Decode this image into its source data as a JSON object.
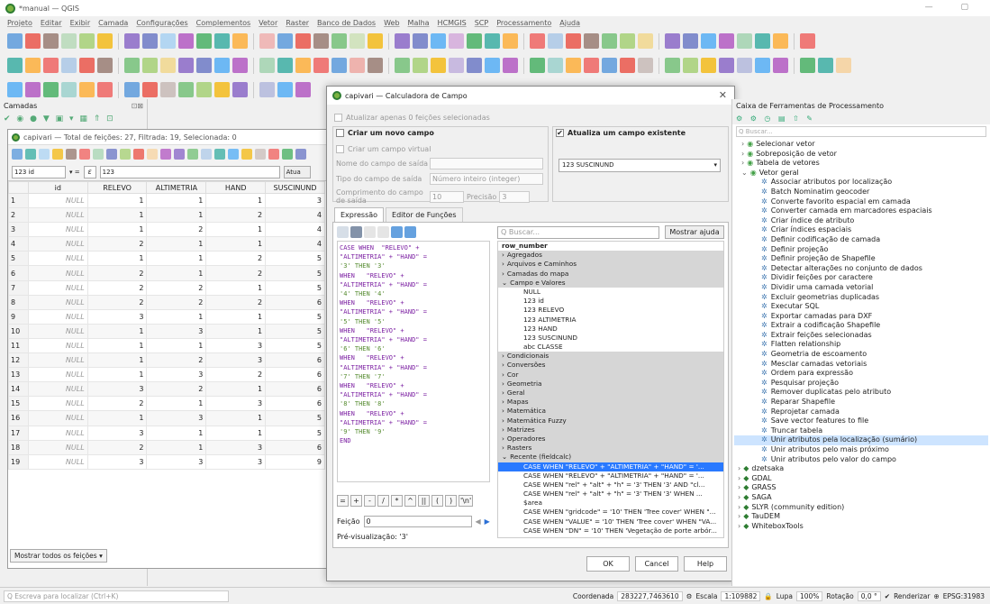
{
  "app": {
    "title": "*manual — QGIS"
  },
  "menu": [
    "Projeto",
    "Editar",
    "Exibir",
    "Camada",
    "Configurações",
    "Complementos",
    "Vetor",
    "Raster",
    "Banco de Dados",
    "Web",
    "Malha",
    "HCMGIS",
    "SCP",
    "Processamento",
    "Ajuda"
  ],
  "layers_panel": {
    "title": "Camadas",
    "close": "⊡⊠"
  },
  "attr": {
    "title": "capivari — Total de feições: 27, Filtrada: 19, Selecionada: 0",
    "field_select": "123 id",
    "expr_value": "123",
    "update_btn": "Atua",
    "columns": [
      "id",
      "RELEVO",
      "ALTIMETRIA",
      "HAND",
      "SUSCINUND"
    ],
    "rows": [
      [
        "1",
        "NULL",
        "1",
        "1",
        "1",
        "3"
      ],
      [
        "2",
        "NULL",
        "1",
        "1",
        "2",
        "4"
      ],
      [
        "3",
        "NULL",
        "1",
        "2",
        "1",
        "4"
      ],
      [
        "4",
        "NULL",
        "2",
        "1",
        "1",
        "4"
      ],
      [
        "5",
        "NULL",
        "1",
        "1",
        "2",
        "5"
      ],
      [
        "6",
        "NULL",
        "2",
        "1",
        "2",
        "5"
      ],
      [
        "7",
        "NULL",
        "2",
        "2",
        "1",
        "5"
      ],
      [
        "8",
        "NULL",
        "2",
        "2",
        "2",
        "6"
      ],
      [
        "9",
        "NULL",
        "3",
        "1",
        "1",
        "5"
      ],
      [
        "10",
        "NULL",
        "1",
        "3",
        "1",
        "5"
      ],
      [
        "11",
        "NULL",
        "1",
        "1",
        "3",
        "5"
      ],
      [
        "12",
        "NULL",
        "1",
        "2",
        "3",
        "6"
      ],
      [
        "13",
        "NULL",
        "1",
        "3",
        "2",
        "6"
      ],
      [
        "14",
        "NULL",
        "3",
        "2",
        "1",
        "6"
      ],
      [
        "15",
        "NULL",
        "2",
        "1",
        "3",
        "6"
      ],
      [
        "16",
        "NULL",
        "1",
        "3",
        "1",
        "5"
      ],
      [
        "17",
        "NULL",
        "3",
        "1",
        "1",
        "5"
      ],
      [
        "18",
        "NULL",
        "2",
        "1",
        "3",
        "6"
      ],
      [
        "19",
        "NULL",
        "3",
        "3",
        "3",
        "9"
      ]
    ],
    "show_all": "Mostrar todos os feições"
  },
  "dialog": {
    "title": "capivari — Calculadora de Campo",
    "update_selected": "Atualizar apenas 0 feições selecionadas",
    "new_field": "Criar um novo campo",
    "virtual": "Criar um campo virtual",
    "out_name": "Nome do campo de saída",
    "out_type": "Tipo do campo de saída",
    "out_type_val": "Número inteiro (integer)",
    "out_len": "Comprimento do campo de saída",
    "out_len_val": "10",
    "precision": "Precisão",
    "precision_val": "3",
    "update_existing": "Atualiza um campo existente",
    "existing_field": "123 SUSCINUND",
    "tab_expr": "Expressão",
    "tab_func": "Editor de Funções",
    "search_ph": "Q Buscar...",
    "help_btn": "Mostrar ajuda",
    "expression": [
      "CASE WHEN  \"RELEVO\" +",
      "\"ALTIMETRIA\" + \"HAND\" =",
      "'3' THEN '3'",
      "WHEN   \"RELEVO\" +",
      "\"ALTIMETRIA\" + \"HAND\" =",
      "'4' THEN '4'",
      "WHEN   \"RELEVO\" +",
      "\"ALTIMETRIA\" + \"HAND\" =",
      "'5' THEN '5'",
      "WHEN   \"RELEVO\" +",
      "\"ALTIMETRIA\" + \"HAND\" =",
      "'6' THEN '6'",
      "WHEN   \"RELEVO\" +",
      "\"ALTIMETRIA\" + \"HAND\" =",
      "'7' THEN '7'",
      "WHEN   \"RELEVO\" +",
      "\"ALTIMETRIA\" + \"HAND\" =",
      "'8' THEN '8'",
      "WHEN   \"RELEVO\" +",
      "\"ALTIMETRIA\" + \"HAND\" =",
      "'9' THEN '9'",
      "END"
    ],
    "operators": [
      "=",
      "+",
      "-",
      "/",
      "*",
      "^",
      "||",
      "(",
      ")",
      "'\\n'"
    ],
    "feature_label": "Feição",
    "feature_val": "0",
    "preview": "Pré-visualização:  '3'",
    "tree": [
      {
        "t": "row_number",
        "lvl": 0,
        "b": true
      },
      {
        "t": "Agregados",
        "lvl": 0,
        "g": true
      },
      {
        "t": "Arquivos e Caminhos",
        "lvl": 0,
        "g": true
      },
      {
        "t": "Camadas do mapa",
        "lvl": 0,
        "g": true
      },
      {
        "t": "Campo e Valores",
        "lvl": 0,
        "g": true,
        "open": true
      },
      {
        "t": "NULL",
        "lvl": 1
      },
      {
        "t": "123  id",
        "lvl": 1
      },
      {
        "t": "123  RELEVO",
        "lvl": 1
      },
      {
        "t": "123  ALTIMETRIA",
        "lvl": 1
      },
      {
        "t": "123  HAND",
        "lvl": 1
      },
      {
        "t": "123  SUSCINUND",
        "lvl": 1
      },
      {
        "t": "abc  CLASSE",
        "lvl": 1
      },
      {
        "t": "Condicionais",
        "lvl": 0,
        "g": true
      },
      {
        "t": "Conversões",
        "lvl": 0,
        "g": true
      },
      {
        "t": "Cor",
        "lvl": 0,
        "g": true
      },
      {
        "t": "Geometria",
        "lvl": 0,
        "g": true
      },
      {
        "t": "Geral",
        "lvl": 0,
        "g": true
      },
      {
        "t": "Mapas",
        "lvl": 0,
        "g": true
      },
      {
        "t": "Matemática",
        "lvl": 0,
        "g": true
      },
      {
        "t": "Matemática Fuzzy",
        "lvl": 0,
        "g": true
      },
      {
        "t": "Matrizes",
        "lvl": 0,
        "g": true
      },
      {
        "t": "Operadores",
        "lvl": 0,
        "g": true
      },
      {
        "t": "Rasters",
        "lvl": 0,
        "g": true
      },
      {
        "t": "Recente (fieldcalc)",
        "lvl": 0,
        "g": true,
        "open": true
      },
      {
        "t": "CASE WHEN  \"RELEVO\" + \"ALTIMETRIA\" + \"HAND\" = '...",
        "lvl": 1,
        "s": true
      },
      {
        "t": "CASE WHEN  \"RELEVO\" + \"ALTIMETRIA\" + \"HAND\" = '...",
        "lvl": 1
      },
      {
        "t": "CASE WHEN \"rel\" + \"alt\" + \"h\" = '3' THEN '3' AND \"cl...",
        "lvl": 1
      },
      {
        "t": "CASE WHEN \"rel\" + \"alt\" + \"h\" = '3' THEN '3' WHEN ...",
        "lvl": 1
      },
      {
        "t": "$area",
        "lvl": 1
      },
      {
        "t": "CASE WHEN \"gridcode\" = '10' THEN 'Tree cover' WHEN \"...",
        "lvl": 1
      },
      {
        "t": "CASE WHEN \"VALUE\" = '10' THEN 'Tree cover' WHEN \"VA...",
        "lvl": 1
      },
      {
        "t": "CASE WHEN \"DN\" = '10' THEN 'Vegetação de porte arbór...",
        "lvl": 1
      }
    ],
    "ok": "OK",
    "cancel": "Cancel",
    "help": "Help"
  },
  "toolbox": {
    "title": "Caixa de Ferramentas de Processamento",
    "search_ph": "Q Buscar...",
    "items": [
      {
        "t": "Selecionar vetor",
        "lvl": 1,
        "q": true
      },
      {
        "t": "Sobreposição de vetor",
        "lvl": 1,
        "q": true
      },
      {
        "t": "Tabela de vetores",
        "lvl": 1,
        "q": true
      },
      {
        "t": "Vetor geral",
        "lvl": 1,
        "q": true,
        "open": true
      },
      {
        "t": "Associar atributos por localização",
        "lvl": 2
      },
      {
        "t": "Batch Nominatim geocoder",
        "lvl": 2
      },
      {
        "t": "Converte favorito espacial em camada",
        "lvl": 2
      },
      {
        "t": "Converter camada em marcadores espaciais",
        "lvl": 2
      },
      {
        "t": "Criar índice de atributo",
        "lvl": 2
      },
      {
        "t": "Criar índices espaciais",
        "lvl": 2
      },
      {
        "t": "Definir codificação de camada",
        "lvl": 2
      },
      {
        "t": "Definir projeção",
        "lvl": 2
      },
      {
        "t": "Definir projeção de Shapefile",
        "lvl": 2
      },
      {
        "t": "Detectar alterações no conjunto de dados",
        "lvl": 2
      },
      {
        "t": "Dividir feições por caractere",
        "lvl": 2
      },
      {
        "t": "Dividir uma camada vetorial",
        "lvl": 2
      },
      {
        "t": "Excluir geometrias duplicadas",
        "lvl": 2
      },
      {
        "t": "Executar SQL",
        "lvl": 2
      },
      {
        "t": "Exportar camadas para DXF",
        "lvl": 2
      },
      {
        "t": "Extrair a codificação Shapefile",
        "lvl": 2
      },
      {
        "t": "Extrair feições selecionadas",
        "lvl": 2
      },
      {
        "t": "Flatten relationship",
        "lvl": 2
      },
      {
        "t": "Geometria de escoamento",
        "lvl": 2
      },
      {
        "t": "Mesclar camadas vetoriais",
        "lvl": 2
      },
      {
        "t": "Ordem para expressão",
        "lvl": 2
      },
      {
        "t": "Pesquisar projeção",
        "lvl": 2
      },
      {
        "t": "Remover duplicatas pelo atributo",
        "lvl": 2
      },
      {
        "t": "Reparar Shapefile",
        "lvl": 2
      },
      {
        "t": "Reprojetar camada",
        "lvl": 2
      },
      {
        "t": "Save vector features to file",
        "lvl": 2
      },
      {
        "t": "Truncar tabela",
        "lvl": 2
      },
      {
        "t": "Unir atributos pela localização (sumário)",
        "lvl": 2,
        "hl": true
      },
      {
        "t": "Unir atributos pelo mais próximo",
        "lvl": 2
      },
      {
        "t": "Unir atributos pelo valor do campo",
        "lvl": 2
      },
      {
        "t": "dzetsaka",
        "lvl": 0
      },
      {
        "t": "GDAL",
        "lvl": 0
      },
      {
        "t": "GRASS",
        "lvl": 0
      },
      {
        "t": "SAGA",
        "lvl": 0
      },
      {
        "t": "SLYR (community edition)",
        "lvl": 0
      },
      {
        "t": "TauDEM",
        "lvl": 0
      },
      {
        "t": "WhiteboxTools",
        "lvl": 0
      }
    ]
  },
  "status": {
    "locate_ph": "Q  Escreva para localizar (Ctrl+K)",
    "coord_label": "Coordenada",
    "coord": "283227,7463610",
    "scale_label": "Escala",
    "scale": "1:109882",
    "mag_label": "Lupa",
    "mag": "100%",
    "rot_label": "Rotação",
    "rot": "0,0 °",
    "render": "Renderizar",
    "crs": "EPSG:31983"
  }
}
